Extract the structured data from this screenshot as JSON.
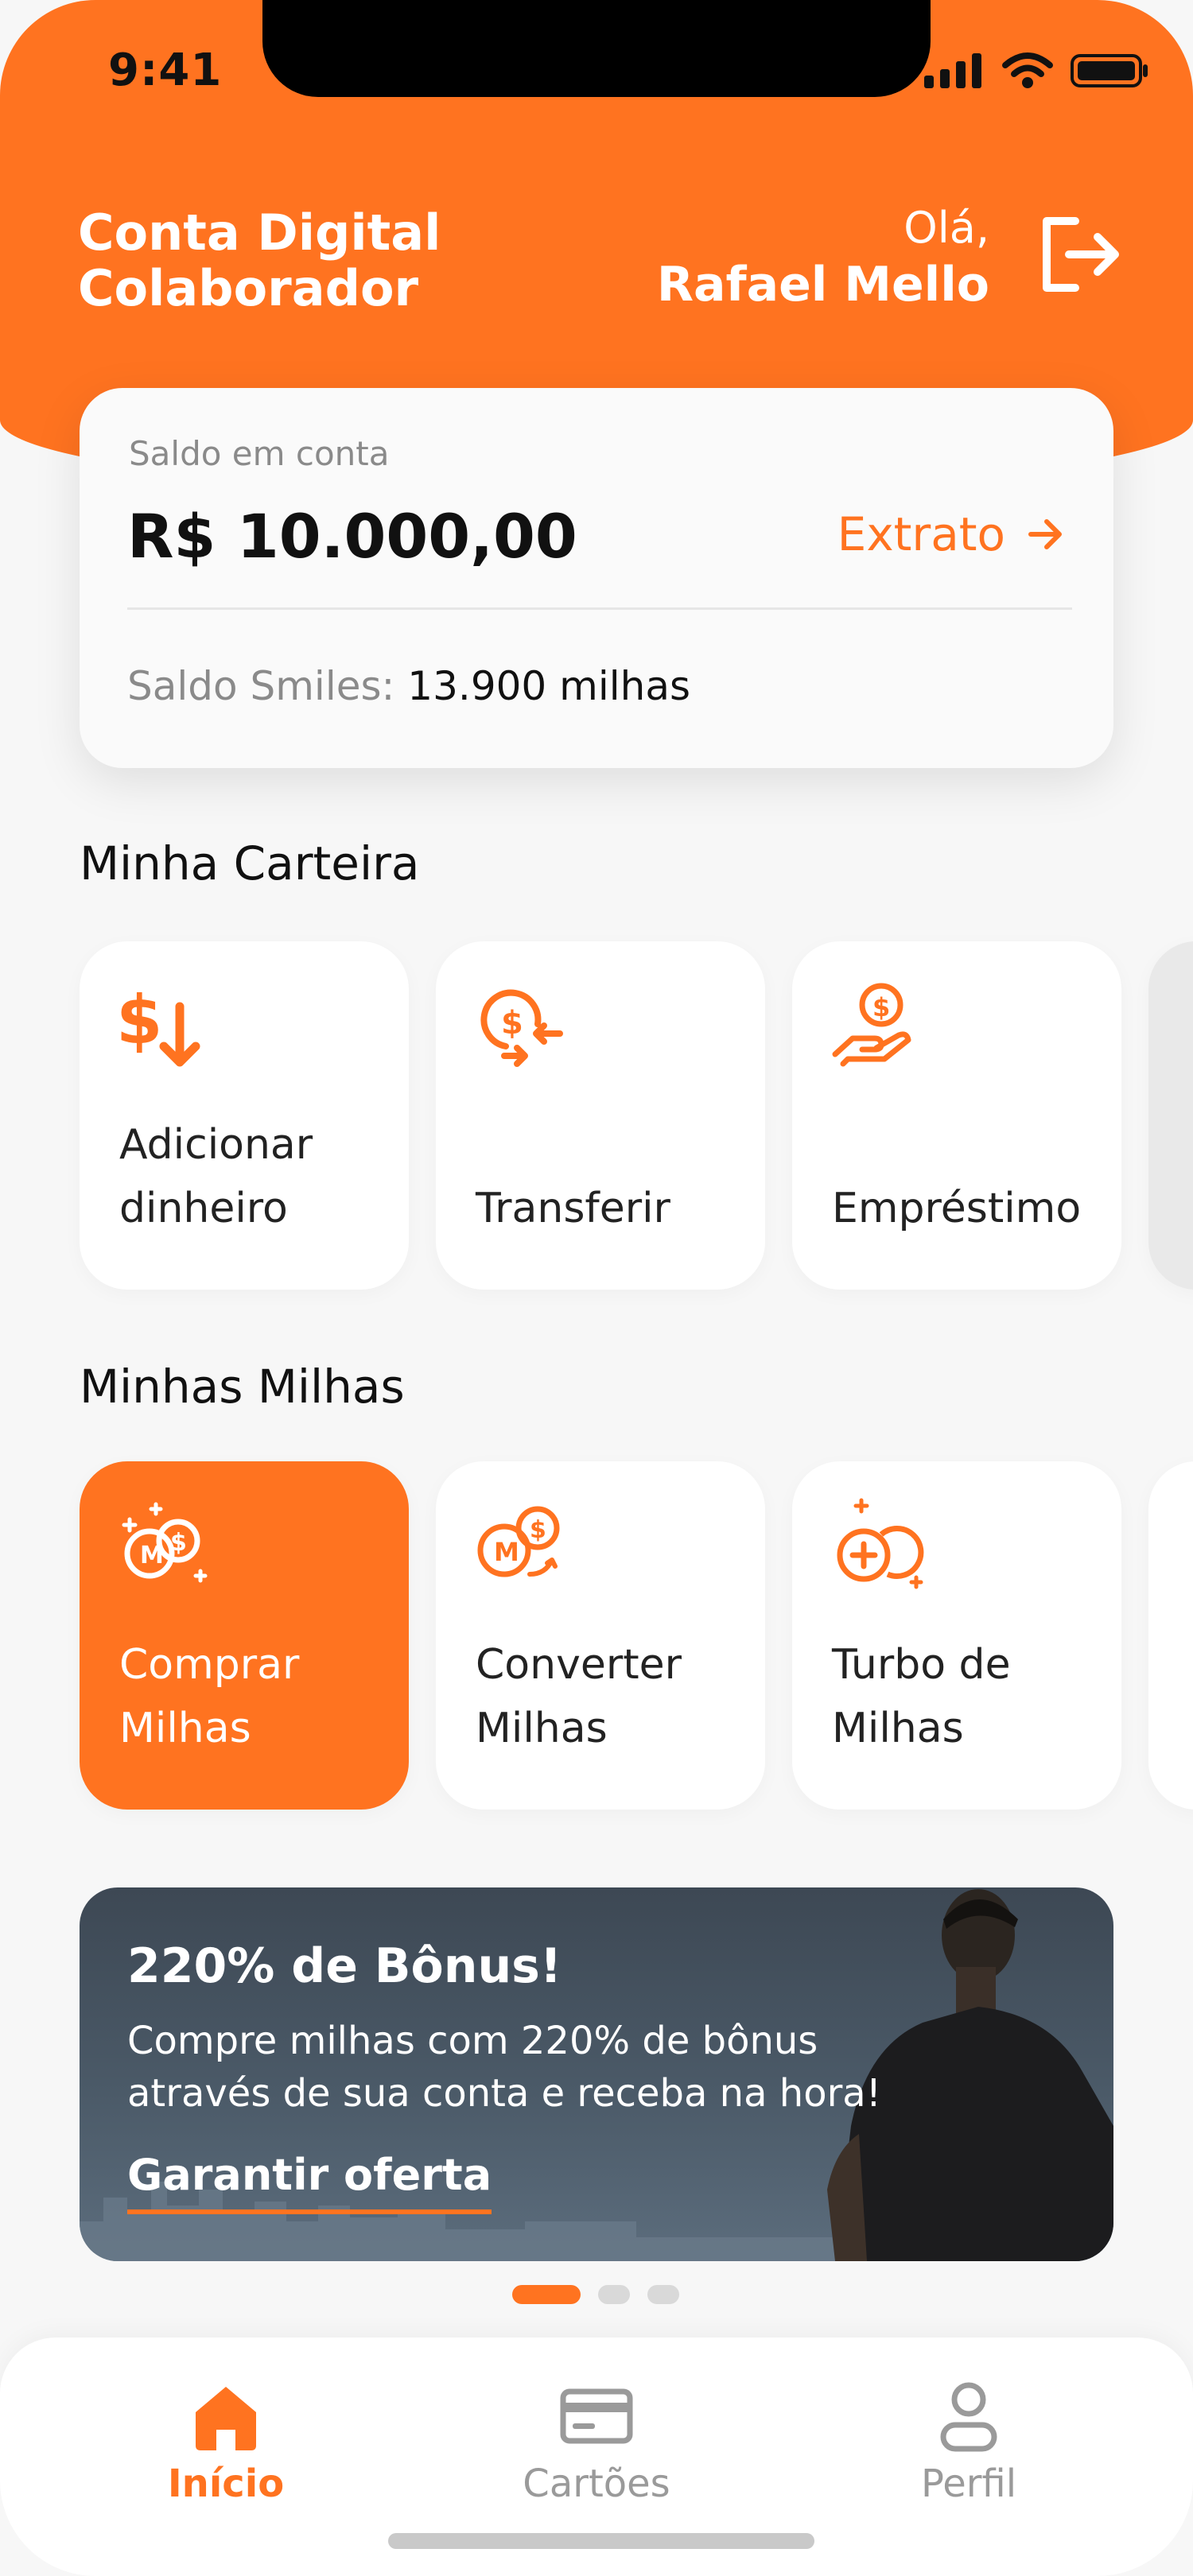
{
  "status": {
    "time": "9:41"
  },
  "header": {
    "brand_line1": "Conta Digital",
    "brand_line2": "Colaborador",
    "greeting": "Olá,",
    "user_name": "Rafael Mello"
  },
  "balance": {
    "label": "Saldo em conta",
    "amount": "R$ 10.000,00",
    "statement_label": "Extrato",
    "smiles_label": "Saldo Smiles:",
    "smiles_value": "13.900 milhas"
  },
  "wallet": {
    "title": "Minha Carteira",
    "items": [
      {
        "label": "Adicionar\ndinheiro",
        "icon": "add-money-icon"
      },
      {
        "label": "Transferir",
        "icon": "transfer-icon"
      },
      {
        "label": "Empréstimo",
        "icon": "loan-icon"
      }
    ]
  },
  "miles": {
    "title": "Minhas Milhas",
    "items": [
      {
        "label": "Comprar\nMilhas",
        "icon": "buy-miles-icon"
      },
      {
        "label": "Converter\nMilhas",
        "icon": "convert-miles-icon"
      },
      {
        "label": "Turbo de\nMilhas",
        "icon": "turbo-miles-icon"
      }
    ]
  },
  "promo": {
    "title": "220% de Bônus!",
    "text": "Compre milhas com 220% de bônus através de sua conta e receba na hora!",
    "cta": "Garantir oferta"
  },
  "nav": {
    "items": [
      {
        "label": "Início",
        "icon": "home-icon"
      },
      {
        "label": "Cartões",
        "icon": "card-icon"
      },
      {
        "label": "Perfil",
        "icon": "user-icon"
      }
    ]
  },
  "colors": {
    "accent": "#ff7320",
    "background": "#f7f7f7"
  }
}
